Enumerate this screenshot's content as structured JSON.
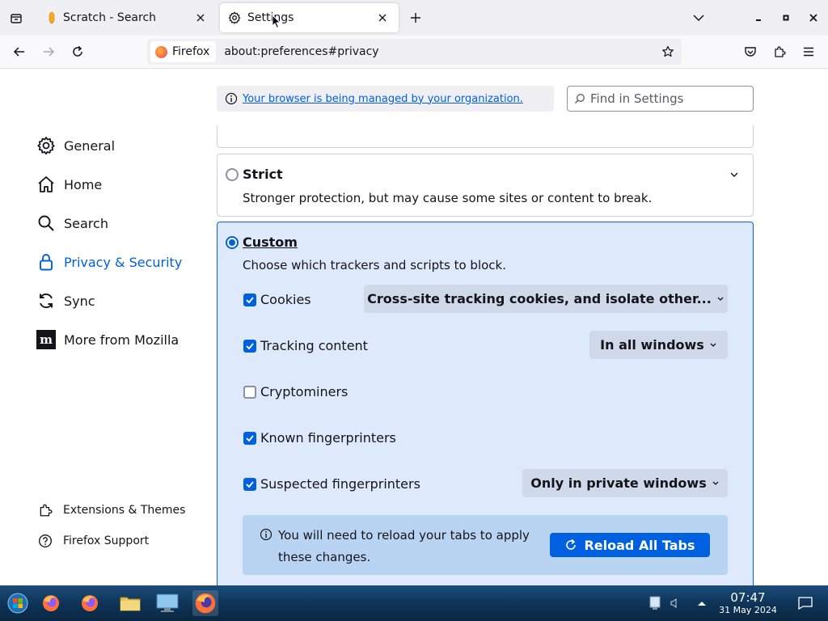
{
  "tabs": [
    {
      "title": "Scratch - Search",
      "icon": "scratch-icon"
    },
    {
      "title": "Settings",
      "icon": "gear-icon",
      "active": true
    }
  ],
  "navbar": {
    "identity_label": "Firefox",
    "url": "about:preferences#privacy"
  },
  "page": {
    "managed_notice": "Your browser is being managed by your organization.",
    "search_placeholder": "Find in Settings"
  },
  "sidebar": {
    "categories": [
      {
        "label": "General",
        "icon": "gear-icon"
      },
      {
        "label": "Home",
        "icon": "home-icon"
      },
      {
        "label": "Search",
        "icon": "search-icon"
      },
      {
        "label": "Privacy & Security",
        "icon": "lock-icon",
        "selected": true
      },
      {
        "label": "Sync",
        "icon": "sync-icon"
      },
      {
        "label": "More from Mozilla",
        "icon": "mozilla-icon"
      }
    ],
    "footer": [
      {
        "label": "Extensions & Themes",
        "icon": "puzzle-icon"
      },
      {
        "label": "Firefox Support",
        "icon": "help-icon"
      }
    ]
  },
  "tracking_protection": {
    "strict": {
      "title": "Strict",
      "description": "Stronger protection, but may cause some sites or content to break.",
      "selected": false
    },
    "custom": {
      "title": "Custom",
      "description": "Choose which trackers and scripts to block.",
      "selected": true,
      "options": [
        {
          "label": "Cookies",
          "checked": true,
          "dropdown": "Cross-site tracking cookies, and isolate other..."
        },
        {
          "label": "Tracking content",
          "checked": true,
          "dropdown": "In all windows"
        },
        {
          "label": "Cryptominers",
          "checked": false
        },
        {
          "label": "Known fingerprinters",
          "checked": true
        },
        {
          "label": "Suspected fingerprinters",
          "checked": true,
          "dropdown": "Only in private windows"
        }
      ],
      "reload_notice": "You will need to reload your tabs to apply these changes.",
      "reload_button": "Reload All Tabs"
    }
  },
  "taskbar": {
    "time": "07:47",
    "date": "31 May 2024"
  },
  "colors": {
    "accent": "#0061e0",
    "custom_card_bg": "#deeafc",
    "tabstrip_bg": "#f0f0f4"
  }
}
